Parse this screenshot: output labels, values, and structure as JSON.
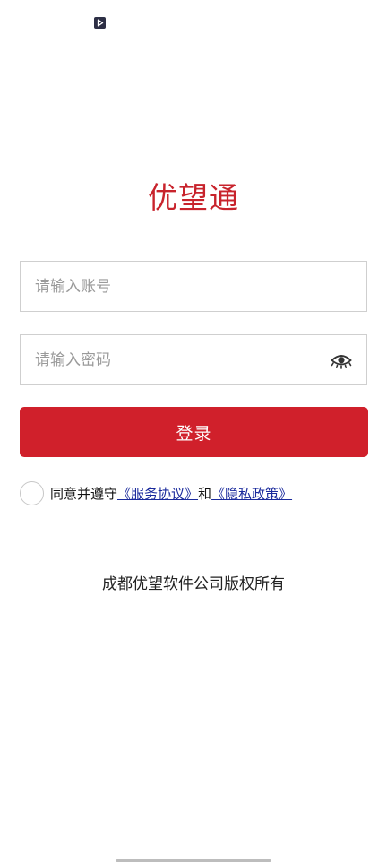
{
  "status_bar": {
    "app_icon": "play-badge-icon"
  },
  "app": {
    "title": "优望通"
  },
  "form": {
    "account_placeholder": "请输入账号",
    "account_value": "",
    "password_placeholder": "请输入密码",
    "password_value": "",
    "password_toggle_icon": "eye-icon",
    "login_label": "登录"
  },
  "agreement": {
    "checked": false,
    "prefix": "同意并遵守",
    "service_link": "《服务协议》",
    "conjunction": "和",
    "privacy_link": "《隐私政策》"
  },
  "footer": {
    "copyright": "成都优望软件公司版权所有"
  },
  "colors": {
    "brand_red": "#d0202b",
    "title_red": "#c8232c",
    "link_blue": "#1a2a9c",
    "field_border": "#cfcfcf"
  }
}
